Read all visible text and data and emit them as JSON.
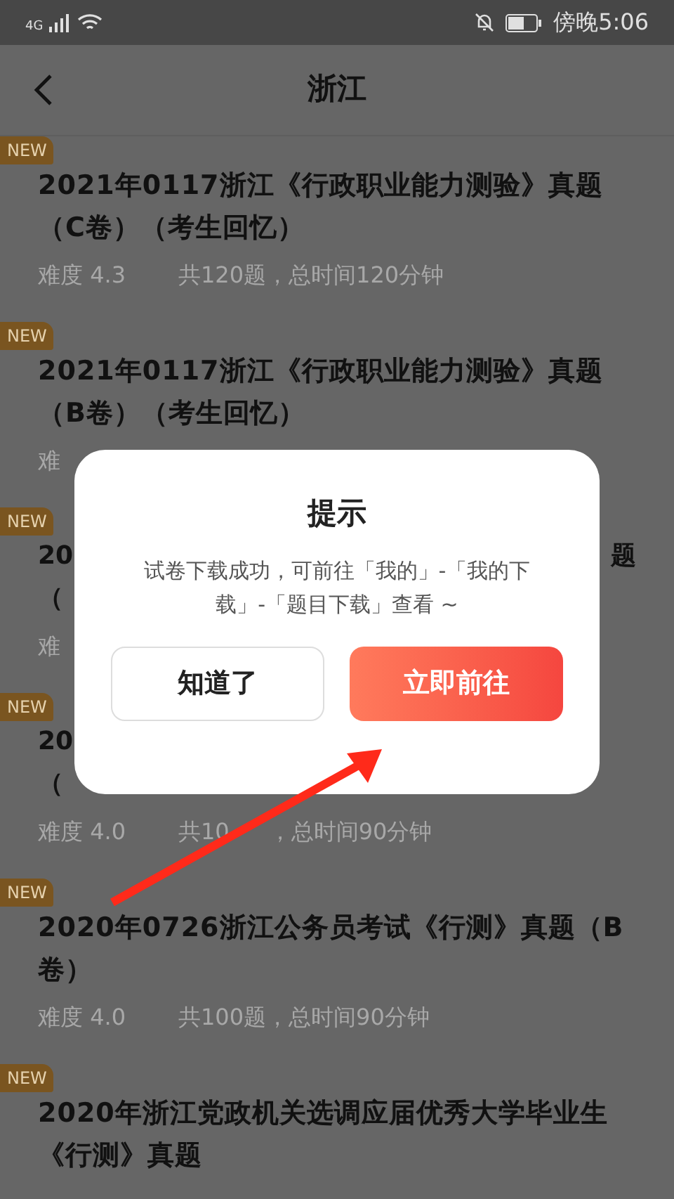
{
  "status_bar": {
    "network": "4G",
    "time": "傍晚5:06"
  },
  "header": {
    "title": "浙江"
  },
  "items": [
    {
      "kind": "full",
      "badge": "NEW",
      "title": "2021年0117浙江《行政职业能力测验》真题（C卷）（考生回忆）",
      "difficulty": "难度 4.3",
      "info": "共120题，总时间120分钟"
    },
    {
      "kind": "full",
      "badge": "NEW",
      "title": "2021年0117浙江《行政职业能力测验》真题（B卷）（考生回忆）",
      "difficulty": "难"
    },
    {
      "kind": "partial",
      "badge": "NEW",
      "title_start": "20",
      "title_end": "题",
      "line2": "（",
      "difficulty": "难"
    },
    {
      "kind": "partial",
      "badge": "NEW",
      "title_start": "20",
      "line2": "（",
      "difficulty": "难度 4.0",
      "info": "共10",
      "info_end": "，总时间90分钟"
    },
    {
      "kind": "full",
      "badge": "NEW",
      "title": "2020年0726浙江公务员考试《行测》真题（B卷）",
      "difficulty": "难度 4.0",
      "info": "共100题，总时间90分钟"
    },
    {
      "kind": "full",
      "badge": "NEW",
      "title": "2020年浙江党政机关选调应届优秀大学毕业生《行测》真题"
    }
  ],
  "dialog": {
    "title": "提示",
    "message": "试卷下载成功，可前往「我的」-「我的下载」-「题目下载」查看 ~",
    "buttons": [
      {
        "label": "知道了",
        "kind": "secondary"
      },
      {
        "label": "立即前往",
        "kind": "primary"
      }
    ]
  }
}
